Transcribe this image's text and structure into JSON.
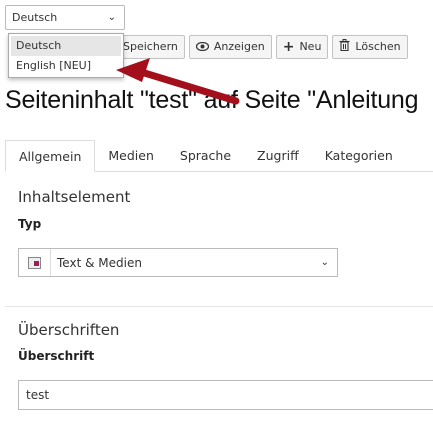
{
  "language_selector": {
    "value": "Deutsch"
  },
  "language_dropdown": {
    "options": [
      "Deutsch",
      "English [NEU]"
    ]
  },
  "toolbar": {
    "save_label": "Speichern",
    "view_label": "Anzeigen",
    "new_label": "Neu",
    "delete_label": "Löschen"
  },
  "page_title": "Seiteninhalt \"test\" auf Seite \"Anleitung",
  "tabs": [
    "Allgemein",
    "Medien",
    "Sprache",
    "Zugriff",
    "Kategorien"
  ],
  "content_element": {
    "heading": "Inhaltselement",
    "type_label": "Typ",
    "type_value": "Text & Medien"
  },
  "headlines": {
    "heading": "Überschriften",
    "header_label": "Überschrift",
    "header_value": "test"
  },
  "colors": {
    "arrow": "#a3101c",
    "accent": "#9b1d5a"
  }
}
